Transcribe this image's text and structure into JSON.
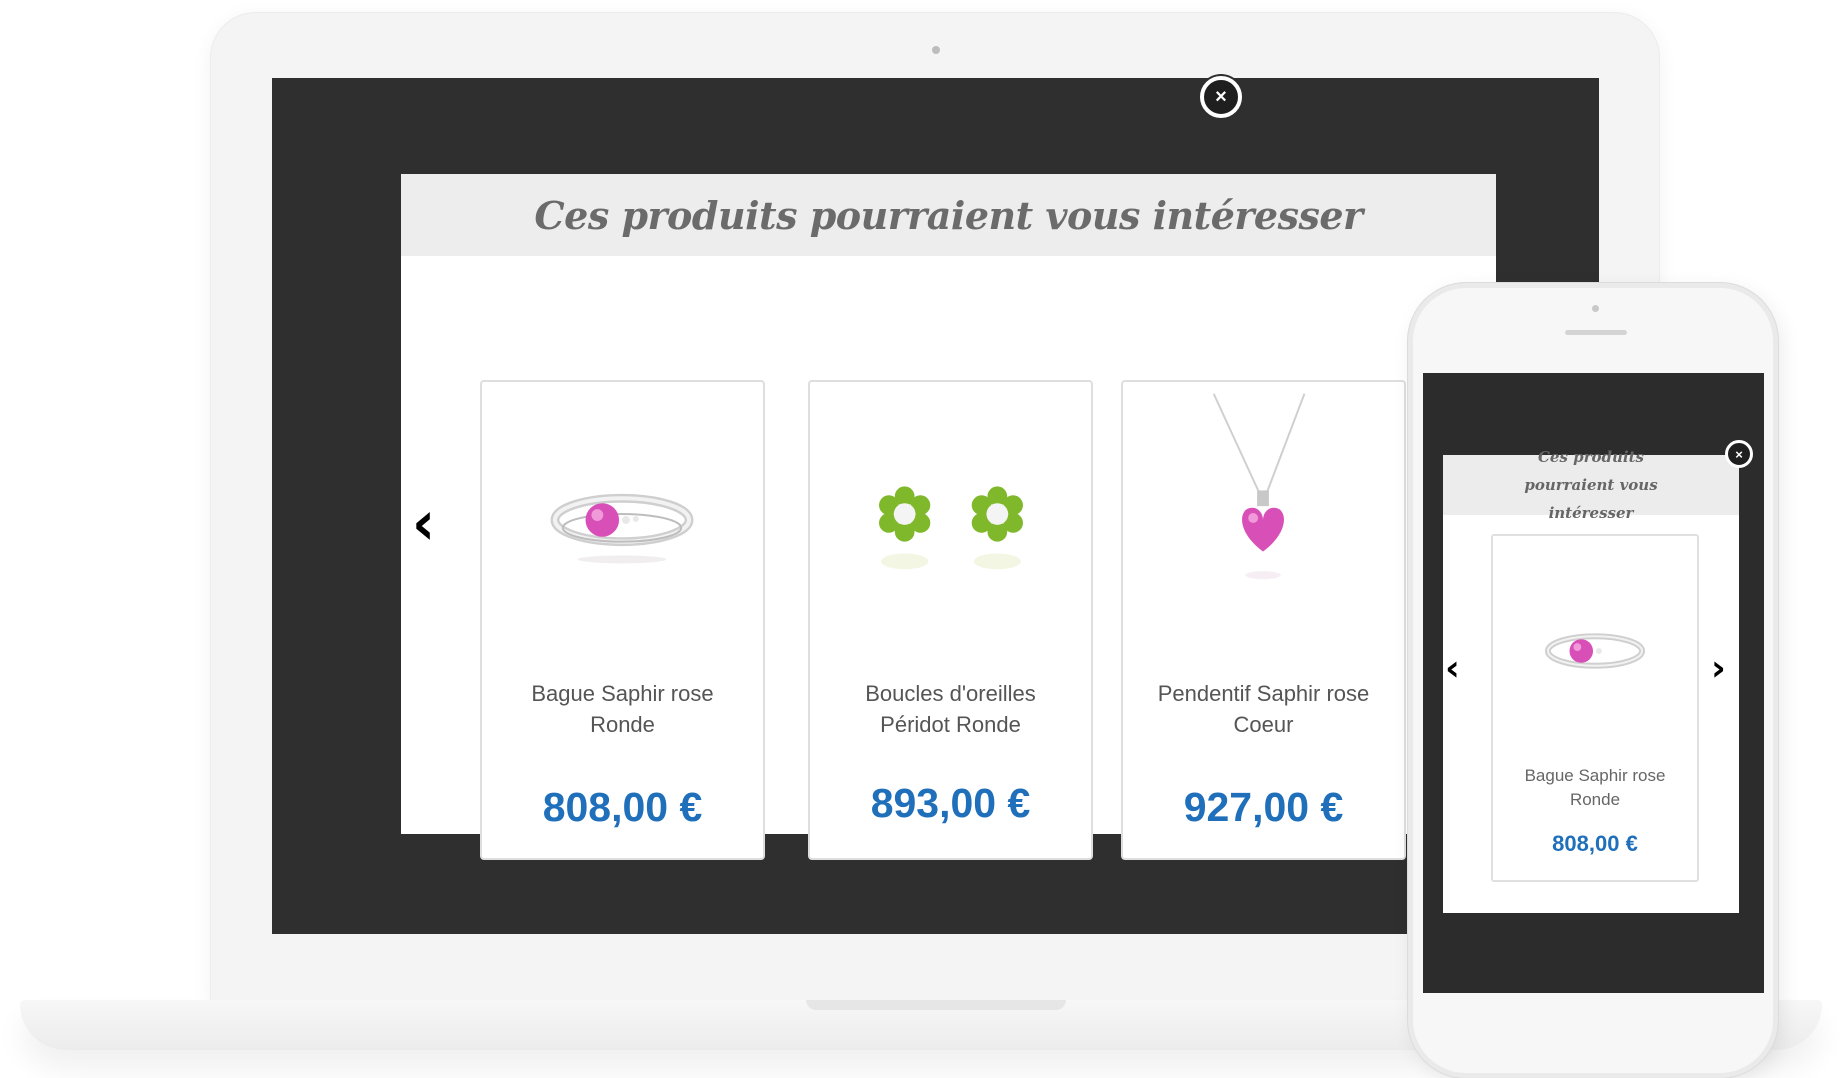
{
  "modal": {
    "title": "Ces produits pourraient vous intéresser",
    "close_icon": "×",
    "prev_icon": "‹",
    "products": [
      {
        "name": "Bague Saphir rose Ronde",
        "price": "808,00 €",
        "image": "pink-sapphire-ring"
      },
      {
        "name": "Boucles d'oreilles Péridot Ronde",
        "price": "893,00 €",
        "image": "peridot-flower-earrings"
      },
      {
        "name": "Pendentif Saphir rose Coeur",
        "price": "927,00 €",
        "image": "pink-sapphire-heart-pendant"
      }
    ]
  },
  "mobile": {
    "title": "Ces produits pourraient vous intéresser",
    "close_icon": "×",
    "prev_icon": "‹",
    "next_icon": "›",
    "product": {
      "name": "Bague Saphir rose Ronde",
      "price": "808,00 €",
      "image": "pink-sapphire-ring"
    }
  },
  "colors": {
    "price": "#1f6fba",
    "overlay": "#2f2f2f",
    "header_bg": "#ededed",
    "gem_pink": "#d94fb8",
    "gem_green": "#7fb82a"
  }
}
